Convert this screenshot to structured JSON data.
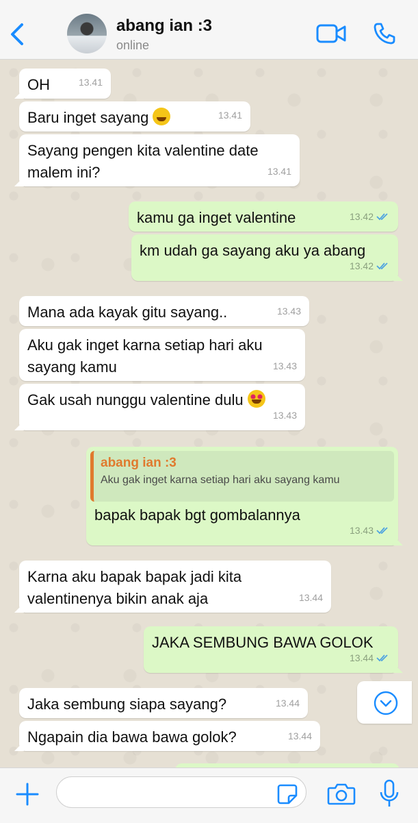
{
  "header": {
    "contact_name": "abang ian :3",
    "status": "online"
  },
  "messages": [
    {
      "text": "OH",
      "time": "13.41",
      "dir": "in"
    },
    {
      "text": "Baru inget sayang",
      "time": "13.41",
      "dir": "in",
      "emoji": "grinning-sweat"
    },
    {
      "text": "Sayang pengen kita valentine date\nmalem ini?",
      "time": "13.41",
      "dir": "in"
    },
    {
      "text": "kamu ga inget valentine",
      "time": "13.42",
      "dir": "out"
    },
    {
      "text": "km udah ga sayang aku ya abang",
      "time": "13.42",
      "dir": "out"
    },
    {
      "text": "Mana ada kayak gitu sayang..",
      "time": "13.43",
      "dir": "in"
    },
    {
      "text": "Aku gak inget karna setiap hari aku\nsayang kamu",
      "time": "13.43",
      "dir": "in"
    },
    {
      "text": "Gak usah nunggu valentine dulu",
      "time": "13.43",
      "dir": "in",
      "emoji": "heart-eyes"
    },
    {
      "text": "bapak bapak bgt gombalannya",
      "time": "13.43",
      "dir": "out",
      "reply": {
        "name": "abang ian :3",
        "text": "Aku gak inget karna setiap hari aku sayang kamu"
      }
    },
    {
      "text": "Karna aku bapak bapak jadi kita\nvalentinenya bikin anak aja",
      "time": "13.44",
      "dir": "in"
    },
    {
      "text": "JAKA SEMBUNG BAWA GOLOK",
      "time": "13.44",
      "dir": "out"
    },
    {
      "text": "Jaka sembung siapa sayang?",
      "time": "13.44",
      "dir": "in"
    },
    {
      "text": "Ngapain dia bawa bawa golok?",
      "time": "13.44",
      "dir": "in"
    }
  ],
  "input": {
    "value": ""
  },
  "colors": {
    "accent": "#1a8cff",
    "outgoing": "#dcf8c6",
    "incoming": "#ffffff",
    "reply_bar": "#e07a2e",
    "read_tick": "#4fa3e0"
  }
}
